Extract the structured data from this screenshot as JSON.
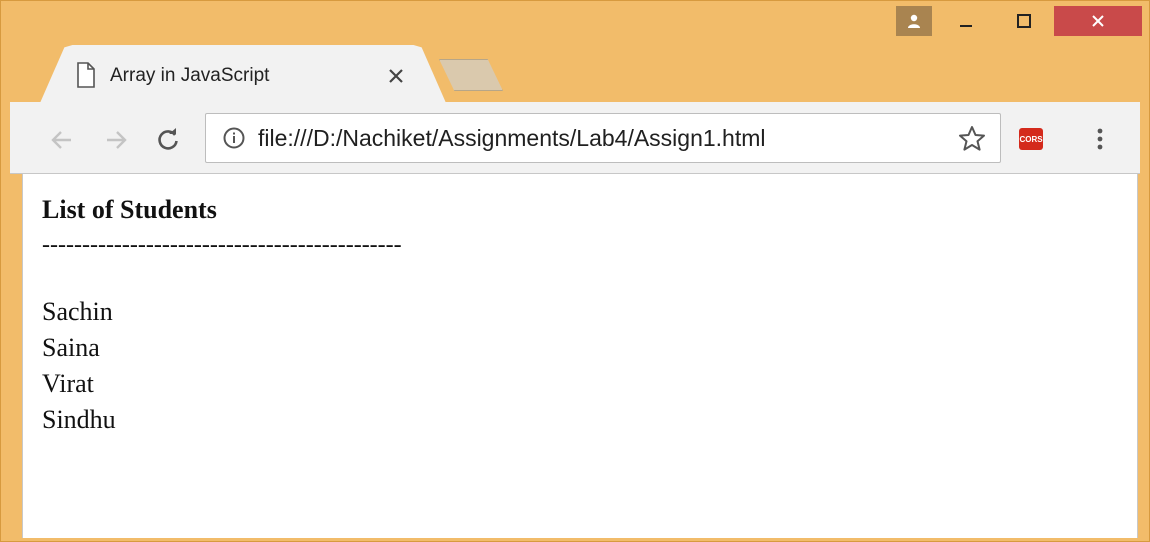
{
  "browser": {
    "tab": {
      "title": "Array in JavaScript",
      "close_glyph": "×"
    },
    "address_bar": {
      "url": "file:///D:/Nachiket/Assignments/Lab4/Assign1.html"
    },
    "extension": {
      "label": "CORS",
      "color": "#d42a1c"
    },
    "icons": [
      "page-icon",
      "close-icon",
      "back-arrow-icon",
      "forward-arrow-icon",
      "reload-icon",
      "info-icon",
      "star-icon",
      "menu-icon",
      "profile-icon",
      "minimize-icon",
      "maximize-icon",
      "close-window-icon"
    ]
  },
  "page": {
    "heading": "List of Students",
    "divider": "---------------------------------------------",
    "students": [
      "Sachin",
      "Saina",
      "Virat",
      "Sindhu"
    ]
  },
  "colors": {
    "frame": "#f2bc6a",
    "toolbar": "#f2f2f2",
    "close_button": "#c94a4a",
    "profile_button": "#a98450"
  }
}
